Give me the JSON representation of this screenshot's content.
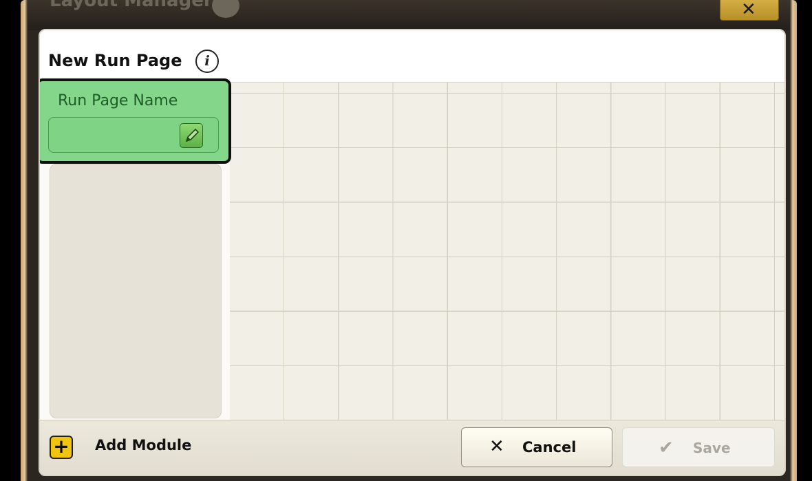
{
  "window": {
    "title": "Layout Manager",
    "close_label": "✕"
  },
  "dialog": {
    "title": "New Run Page",
    "info_glyph": "i"
  },
  "name_module": {
    "label": "Run Page Name",
    "value": ""
  },
  "footer": {
    "add_label": "Add Module",
    "add_glyph": "+",
    "cancel_glyph": "✕",
    "cancel_label": "Cancel",
    "save_glyph": "✔",
    "save_label": "Save"
  },
  "colors": {
    "selected_module": "#84d68a",
    "add_icon": "#f1c40f"
  }
}
